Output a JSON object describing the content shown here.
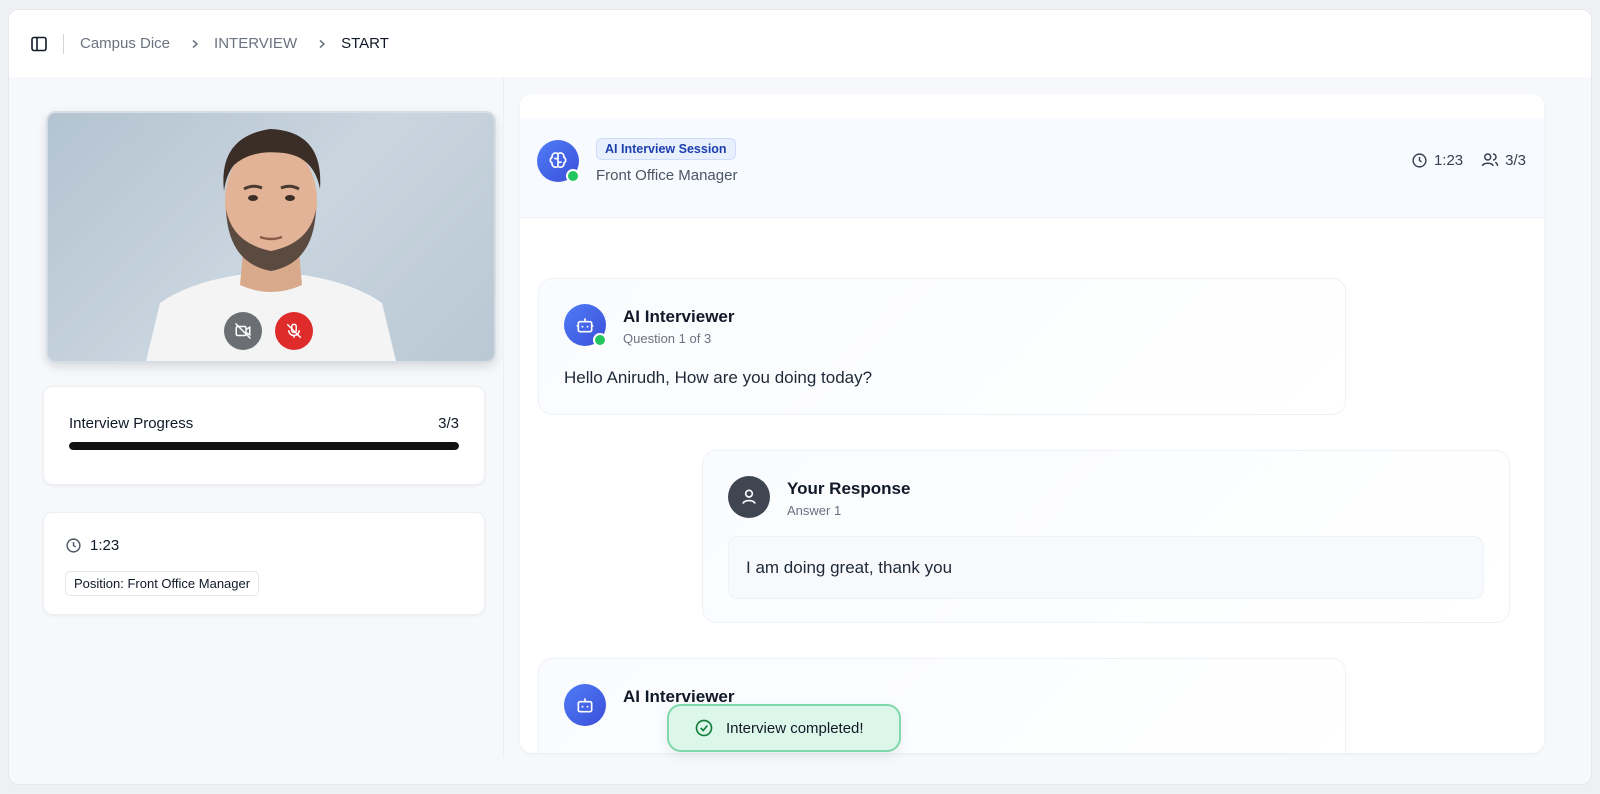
{
  "breadcrumb": {
    "items": [
      "Campus Dice",
      "INTERVIEW",
      "START"
    ]
  },
  "video": {
    "camera_state": "off",
    "mic_state": "muted"
  },
  "progress": {
    "label": "Interview Progress",
    "count": "3/3",
    "fraction": 1.0
  },
  "info": {
    "timer": "1:23",
    "position": "Position: Front Office Manager"
  },
  "session": {
    "badge": "AI Interview Session",
    "role": "Front Office Manager",
    "timer": "1:23",
    "participants": "3/3"
  },
  "messages": [
    {
      "title": "AI Interviewer",
      "subtitle": "Question 1 of 3",
      "text": "Hello Anirudh, How are you doing today?"
    },
    {
      "title": "Your Response",
      "subtitle": "Answer 1",
      "text": "I am doing great, thank you"
    },
    {
      "title": "AI Interviewer"
    }
  ],
  "toast": {
    "text": "Interview completed!"
  },
  "colors": {
    "accent": "#3b4fd8",
    "online": "#22c55e",
    "mic_off": "#e02b2b",
    "toast_bg": "#dcf7ea"
  }
}
